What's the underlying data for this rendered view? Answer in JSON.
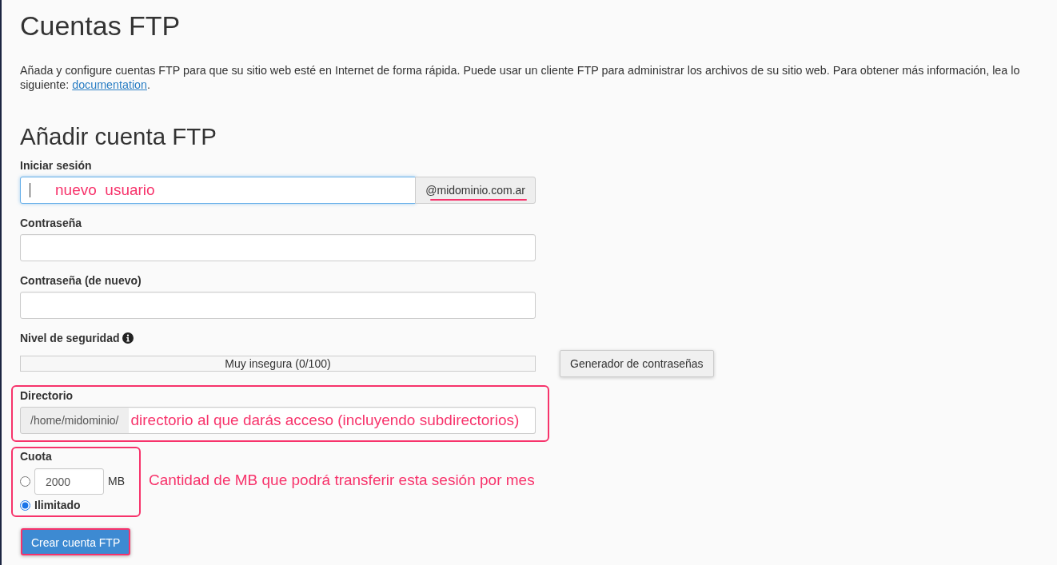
{
  "page": {
    "title": "Cuentas FTP",
    "intro": {
      "text": "Añada y configure cuentas FTP para que su sitio web esté en Internet de forma rápida. Puede usar un cliente FTP para administrar los archivos de su sitio web. Para obtener más información, lea lo siguiente:",
      "link": "documentation",
      "end": "."
    }
  },
  "form": {
    "title": "Añadir cuenta FTP",
    "login": {
      "label": "Iniciar sesión",
      "value": "nuevo  usuario",
      "focused": true,
      "suffix": "@midominio.com.ar",
      "suffix_marked": true
    },
    "password": {
      "label": "Contraseña"
    },
    "password_again": {
      "label": "Contraseña (de nuevo)"
    },
    "strength": {
      "label": "Nivel de seguridad",
      "level": 0,
      "reading": "Muy insegura (0/100)"
    },
    "generator_button": "Generador de contraseñas",
    "directory": {
      "label": "Directorio",
      "prefix": "/home/midominio/",
      "value": "directorio al que darás acceso (incluyendo subdirectorios)",
      "marked": true
    },
    "quota": {
      "label": "Cuota",
      "marked": true,
      "options": [
        {
          "kind": "amount",
          "value": "2000",
          "unit": "MB",
          "selected": false
        },
        {
          "kind": "unlimited",
          "label": "Ilimitado",
          "selected": true
        }
      ],
      "note": "Cantidad de MB que podrá transferir esta sesión por mes"
    },
    "submit": {
      "label": "Crear cuenta FTP",
      "marked": true
    }
  }
}
